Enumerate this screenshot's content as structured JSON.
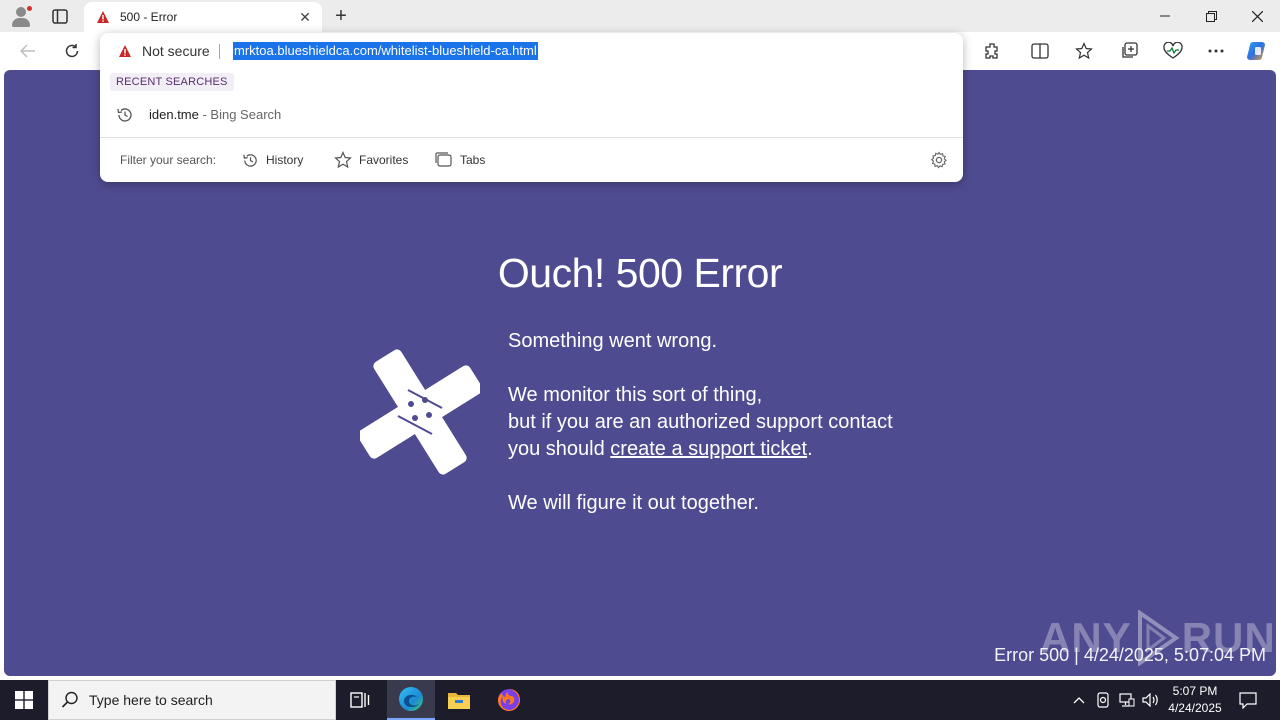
{
  "browser": {
    "tab": {
      "title": "500 - Error"
    },
    "address_bar": {
      "security_label": "Not secure",
      "url": "mrktoa.blueshieldca.com/whitelist-blueshield-ca.html"
    },
    "suggestions": {
      "section_label": "RECENT SEARCHES",
      "items": [
        {
          "term": "iden.tme",
          "source": " - Bing Search"
        }
      ],
      "filter_label": "Filter your search:",
      "filters": [
        "History",
        "Favorites",
        "Tabs"
      ]
    }
  },
  "page": {
    "title": "Ouch! 500 Error",
    "line1": "Something went wrong.",
    "line2": "We monitor this sort of thing,",
    "line3": "but if you are an authorized support contact",
    "line4_prefix": "you should ",
    "support_link": "create a support ticket",
    "line4_suffix": ".",
    "line5": "We will figure it out together.",
    "footer": "Error 500 | 4/24/2025, 5:07:04 PM",
    "background_color": "#4f4b91"
  },
  "watermark": {
    "left": "ANY",
    "right": "RUN"
  },
  "taskbar": {
    "search_placeholder": "Type here to search",
    "time": "5:07 PM",
    "date": "4/24/2025"
  }
}
